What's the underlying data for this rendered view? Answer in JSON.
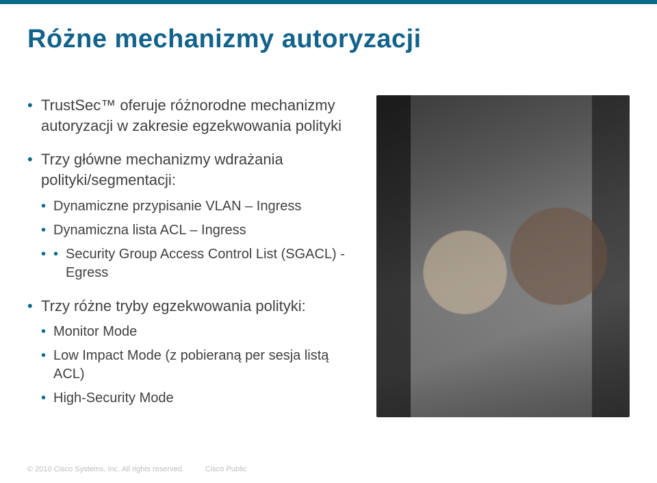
{
  "title": "Różne mechanizmy autoryzacji",
  "bullets": {
    "b1": "TrustSec™ oferuje różnorodne mechanizmy autoryzacji w zakresie egzekwowania polityki",
    "b2": "Trzy główne mechanizmy wdrażania polityki/segmentacji:",
    "b2_sub": {
      "s1": "Dynamiczne przypisanie VLAN – Ingress",
      "s2": "Dynamiczna lista ACL – Ingress",
      "s3": "Security Group Access Control List (SGACL) - Egress"
    },
    "b3": "Trzy różne tryby egzekwowania polityki:",
    "b3_sub": {
      "s1": "Monitor Mode",
      "s2": "Low Impact Mode (z pobieraną per sesja listą ACL)",
      "s3": "High-Security Mode"
    }
  },
  "footer": {
    "copyright": "© 2010 Cisco Systems, Inc. All rights reserved.",
    "label": "Cisco Public"
  },
  "image": {
    "alt": "datacenter-technicians-photo"
  }
}
